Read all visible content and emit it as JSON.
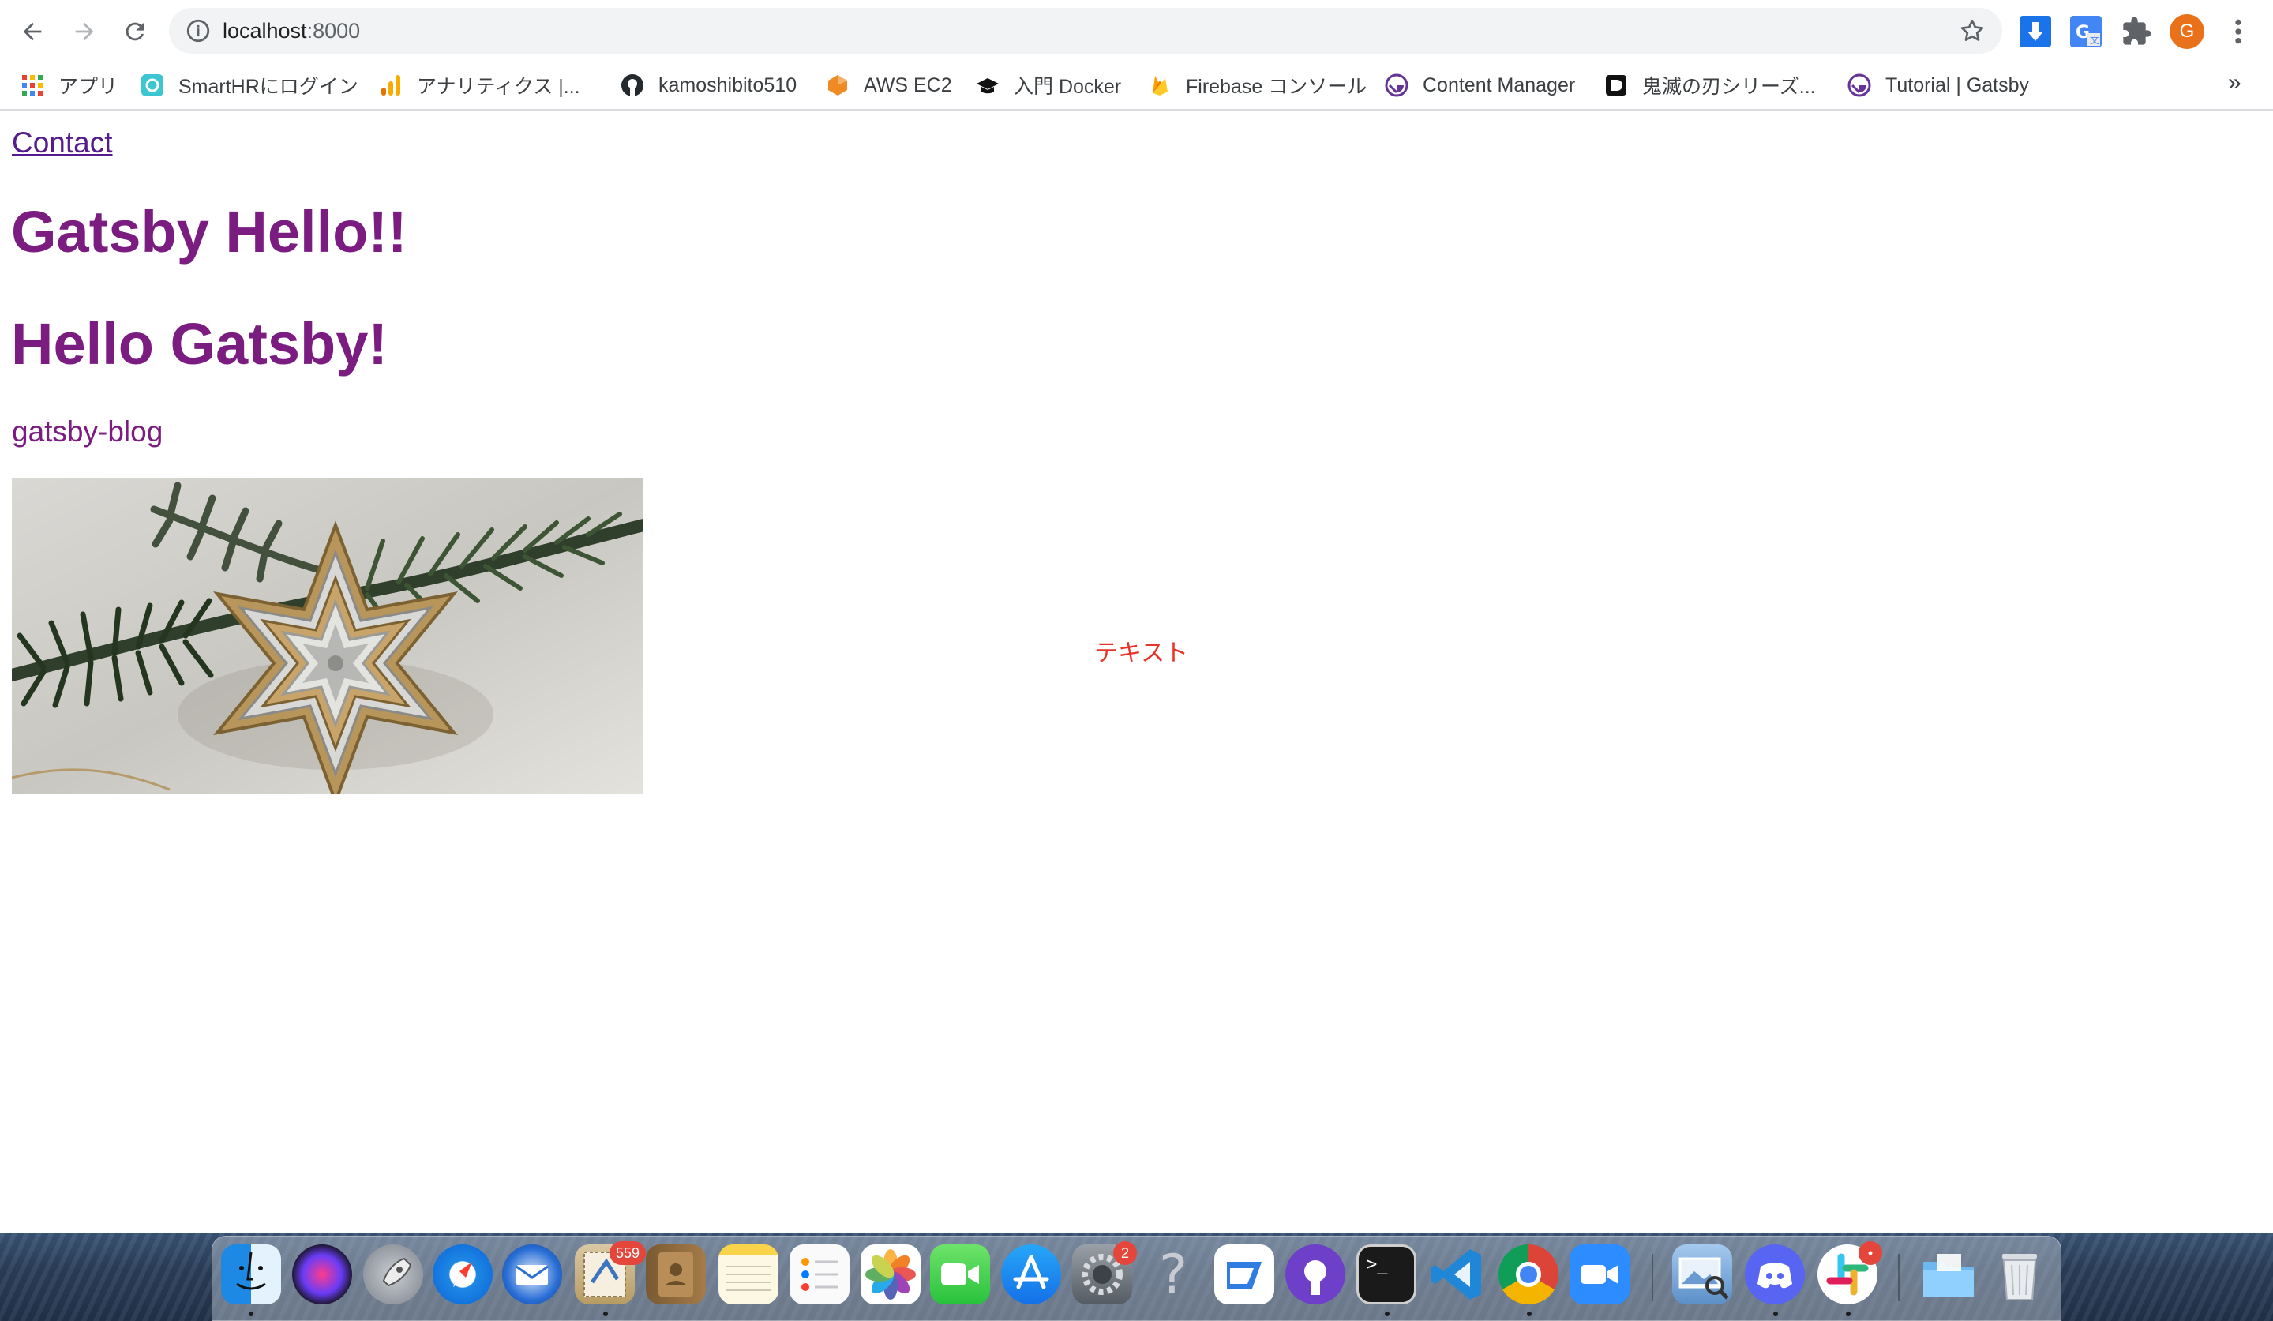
{
  "browser": {
    "url_host": "localhost",
    "url_port": ":8000",
    "profile_initial": "G"
  },
  "bookmarks": [
    {
      "label": "アプリ",
      "icon": "apps-grid-icon"
    },
    {
      "label": "SmartHRにログイン",
      "icon": "smarthr-icon"
    },
    {
      "label": "アナリティクス |...",
      "icon": "analytics-icon"
    },
    {
      "label": "kamoshibito510",
      "icon": "github-icon"
    },
    {
      "label": "AWS EC2",
      "icon": "aws-icon"
    },
    {
      "label": "入門 Docker",
      "icon": "mortarboard-icon"
    },
    {
      "label": "Firebase コンソール",
      "icon": "firebase-icon"
    },
    {
      "label": "Content Manager",
      "icon": "gatsby-icon"
    },
    {
      "label": "鬼滅の刃シリーズ...",
      "icon": "dmm-icon"
    },
    {
      "label": "Tutorial | Gatsby",
      "icon": "gatsby-icon"
    }
  ],
  "bookmarks_more": "»",
  "page": {
    "contact_link": "Contact",
    "heading_1": "Gatsby Hello!!",
    "heading_2": "Hello Gatsby!",
    "site_name": "gatsby-blog",
    "red_text": "テキスト",
    "image": "christmas-star-ornament-image"
  },
  "dock": {
    "apps": [
      "Finder",
      "Siri",
      "Launchpad",
      "Safari",
      "Thunderbird",
      "Mail",
      "Contacts",
      "Notes",
      "Reminders",
      "Photos",
      "FaceTime",
      "App Store",
      "System Preferences",
      "Help",
      "Email client",
      "GitHub Desktop",
      "Terminal",
      "Visual Studio Code",
      "Chrome",
      "Zoom",
      "Preview",
      "Discord",
      "Slack",
      "Downloads",
      "Trash"
    ],
    "mail_badge": "559",
    "prefs_badge": "2",
    "slack_badge": "•"
  },
  "colors": {
    "visited_link": "#551a8b",
    "heading": "#7a1c80",
    "red_text": "#e8332a"
  }
}
